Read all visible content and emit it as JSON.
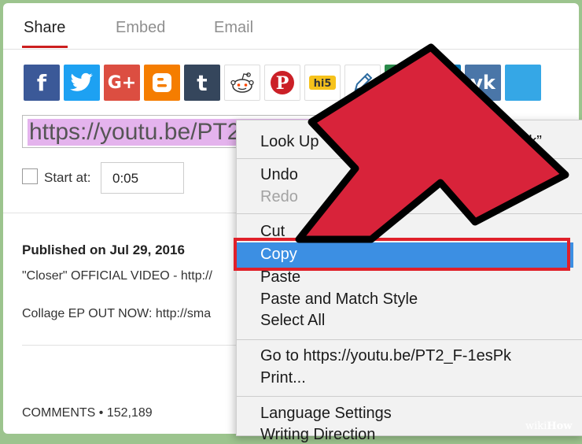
{
  "tabs": [
    {
      "label": "Share"
    },
    {
      "label": "Embed"
    },
    {
      "label": "Email"
    }
  ],
  "social_buttons": [
    {
      "name": "facebook-icon",
      "glyph": "f",
      "color": "#3b5998"
    },
    {
      "name": "twitter-icon",
      "glyph": "t",
      "color": "#1da1f2"
    },
    {
      "name": "google-plus-icon",
      "glyph": "G+",
      "color": "#dc4e41"
    },
    {
      "name": "blogger-icon",
      "glyph": "B",
      "color": "#f57d00"
    },
    {
      "name": "tumblr-icon",
      "glyph": "t",
      "color": "#35465c"
    },
    {
      "name": "reddit-icon",
      "glyph": "reddit",
      "color": "#ffffff"
    },
    {
      "name": "pinterest-icon",
      "glyph": "P",
      "color": "#cb2027"
    },
    {
      "name": "hi5-icon",
      "glyph": "hi5",
      "color": "#ffffff"
    },
    {
      "name": "pencil-icon",
      "glyph": "✎",
      "color": "#2c6ba0"
    },
    {
      "name": "stumbleupon-icon",
      "glyph": "su",
      "color": "#2a8a4a"
    },
    {
      "name": "linkedin-icon",
      "glyph": "in",
      "color": "#0077b5"
    },
    {
      "name": "vk-icon",
      "glyph": "vk",
      "color": "#4a76a8"
    },
    {
      "name": "share-more-icon",
      "glyph": "",
      "color": "#35a7e6"
    }
  ],
  "url": {
    "value": "https://youtu.be/PT2_F-1esPk"
  },
  "start_at": {
    "label": "Start at:",
    "value": "0:05"
  },
  "description": {
    "published": "Published on Jul 29, 2016",
    "line1": "\"Closer\" OFFICIAL VIDEO - http://",
    "line2": "Collage EP OUT NOW: http://sma"
  },
  "comments": {
    "label": "COMMENTS • 152,189"
  },
  "context_menu": {
    "look_up": "Look Up “https://youtu.be/PT2_F-1esPk”",
    "undo": "Undo",
    "redo": "Redo",
    "cut": "Cut",
    "copy": "Copy",
    "paste": "Paste",
    "paste_match": "Paste and Match Style",
    "select_all": "Select All",
    "go_to": "Go to https://youtu.be/PT2_F-1esPk",
    "print": "Print...",
    "language": "Language Settings",
    "writing": "Writing Direction"
  },
  "watermark": {
    "prefix": "wiki",
    "suffix": "How"
  },
  "colors": {
    "accent_tab": "#cc1f1f",
    "highlight": "#3c8fe3",
    "arrow": "#d8233a",
    "frame": "#e0202a"
  }
}
